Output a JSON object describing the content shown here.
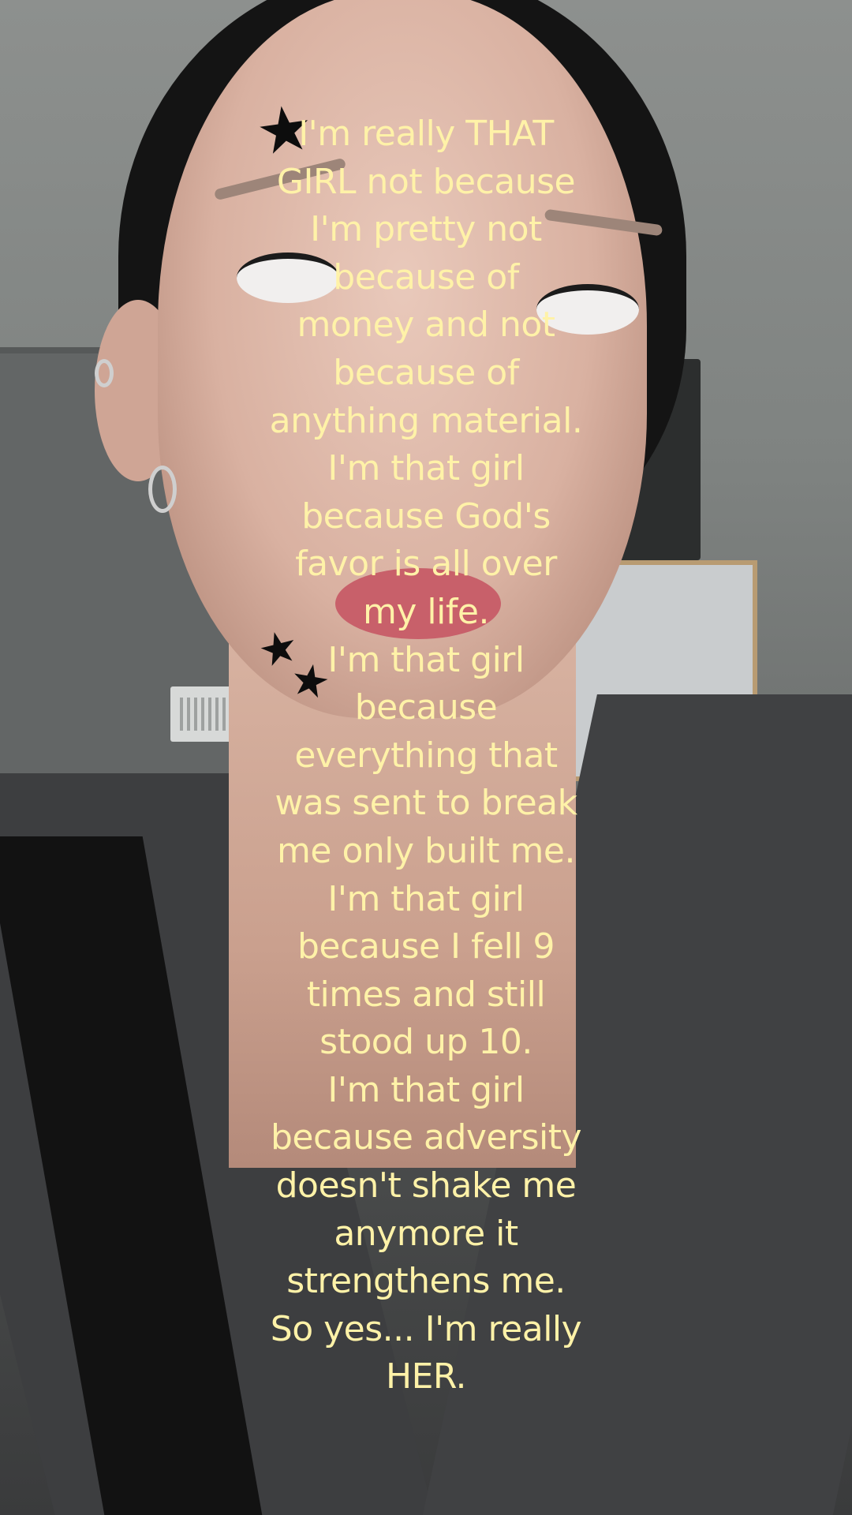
{
  "caption": {
    "color": "#fff2a8",
    "lines": [
      "I'm really THAT",
      "GIRL not because",
      "I'm pretty not",
      "because of",
      "money and not",
      "because of",
      "anything material.",
      "I'm that girl",
      "because God's",
      "favor is all over",
      "my life.",
      "I'm that girl",
      "because",
      "everything that",
      "was sent to break",
      "me only built me.",
      "I'm that girl",
      "because I fell 9",
      "times and still",
      "stood up 10.",
      "I'm that girl",
      "because adversity",
      "doesn't shake me",
      "anymore it",
      "strengthens me.",
      "So yes... I'm really",
      "HER."
    ]
  },
  "stickers": {
    "forehead": "★",
    "cheek_1": "★",
    "cheek_2": "★"
  }
}
